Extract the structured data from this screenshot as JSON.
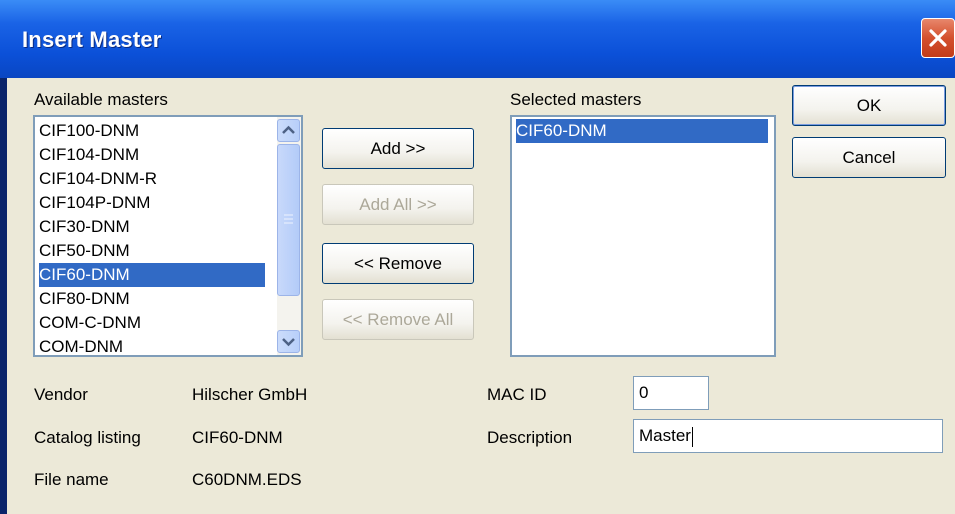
{
  "window": {
    "title": "Insert Master"
  },
  "available": {
    "label": "Available masters",
    "items": [
      "CIF100-DNM",
      "CIF104-DNM",
      "CIF104-DNM-R",
      "CIF104P-DNM",
      "CIF30-DNM",
      "CIF50-DNM",
      "CIF60-DNM",
      "CIF80-DNM",
      "COM-C-DNM",
      "COM-DNM"
    ],
    "selected": "CIF60-DNM"
  },
  "selected_masters": {
    "label": "Selected masters",
    "items": [
      "CIF60-DNM"
    ]
  },
  "buttons": {
    "add": "Add >>",
    "add_all": "Add All >>",
    "remove": "<< Remove",
    "remove_all": "<< Remove All",
    "ok": "OK",
    "cancel": "Cancel"
  },
  "details": {
    "vendor_label": "Vendor",
    "vendor_value": "Hilscher GmbH",
    "catalog_label": "Catalog listing",
    "catalog_value": "CIF60-DNM",
    "file_label": "File name",
    "file_value": "C60DNM.EDS",
    "mac_label": "MAC ID",
    "mac_value": "0",
    "desc_label": "Description",
    "desc_value": "Master"
  },
  "colors": {
    "title_bar": "#0b50d8",
    "selection": "#316ac5",
    "dialog_bg": "#ece9d8"
  },
  "icons": [
    "close-icon",
    "scroll-up-icon",
    "scroll-down-icon"
  ]
}
